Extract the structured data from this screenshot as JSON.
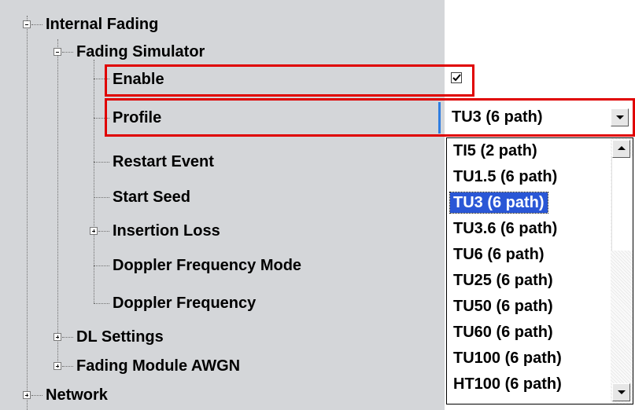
{
  "tree": {
    "items": [
      {
        "label": "Internal Fading",
        "expander": "minus"
      },
      {
        "label": "Fading Simulator",
        "expander": "minus"
      },
      {
        "label": "Enable"
      },
      {
        "label": "Profile"
      },
      {
        "label": "Restart Event"
      },
      {
        "label": "Start Seed"
      },
      {
        "label": "Insertion Loss",
        "expander": "plus"
      },
      {
        "label": "Doppler Frequency Mode"
      },
      {
        "label": "Doppler Frequency"
      },
      {
        "label": "DL Settings",
        "expander": "plus"
      },
      {
        "label": "Fading Module AWGN",
        "expander": "plus"
      },
      {
        "label": "Network",
        "expander": "plus"
      }
    ]
  },
  "enable": {
    "checked": true
  },
  "profile": {
    "selected": "TU3 (6 path)",
    "options": [
      "TI5 (2 path)",
      "TU1.5 (6 path)",
      "TU3 (6 path)",
      "TU3.6 (6 path)",
      "TU6 (6 path)",
      "TU25 (6 path)",
      "TU50 (6 path)",
      "TU60 (6 path)",
      "TU100 (6 path)",
      "HT100 (6 path)"
    ]
  },
  "colors": {
    "tree_background": "#d4d6d9",
    "highlight_border": "#e00000",
    "selection": "#2a57d6"
  }
}
